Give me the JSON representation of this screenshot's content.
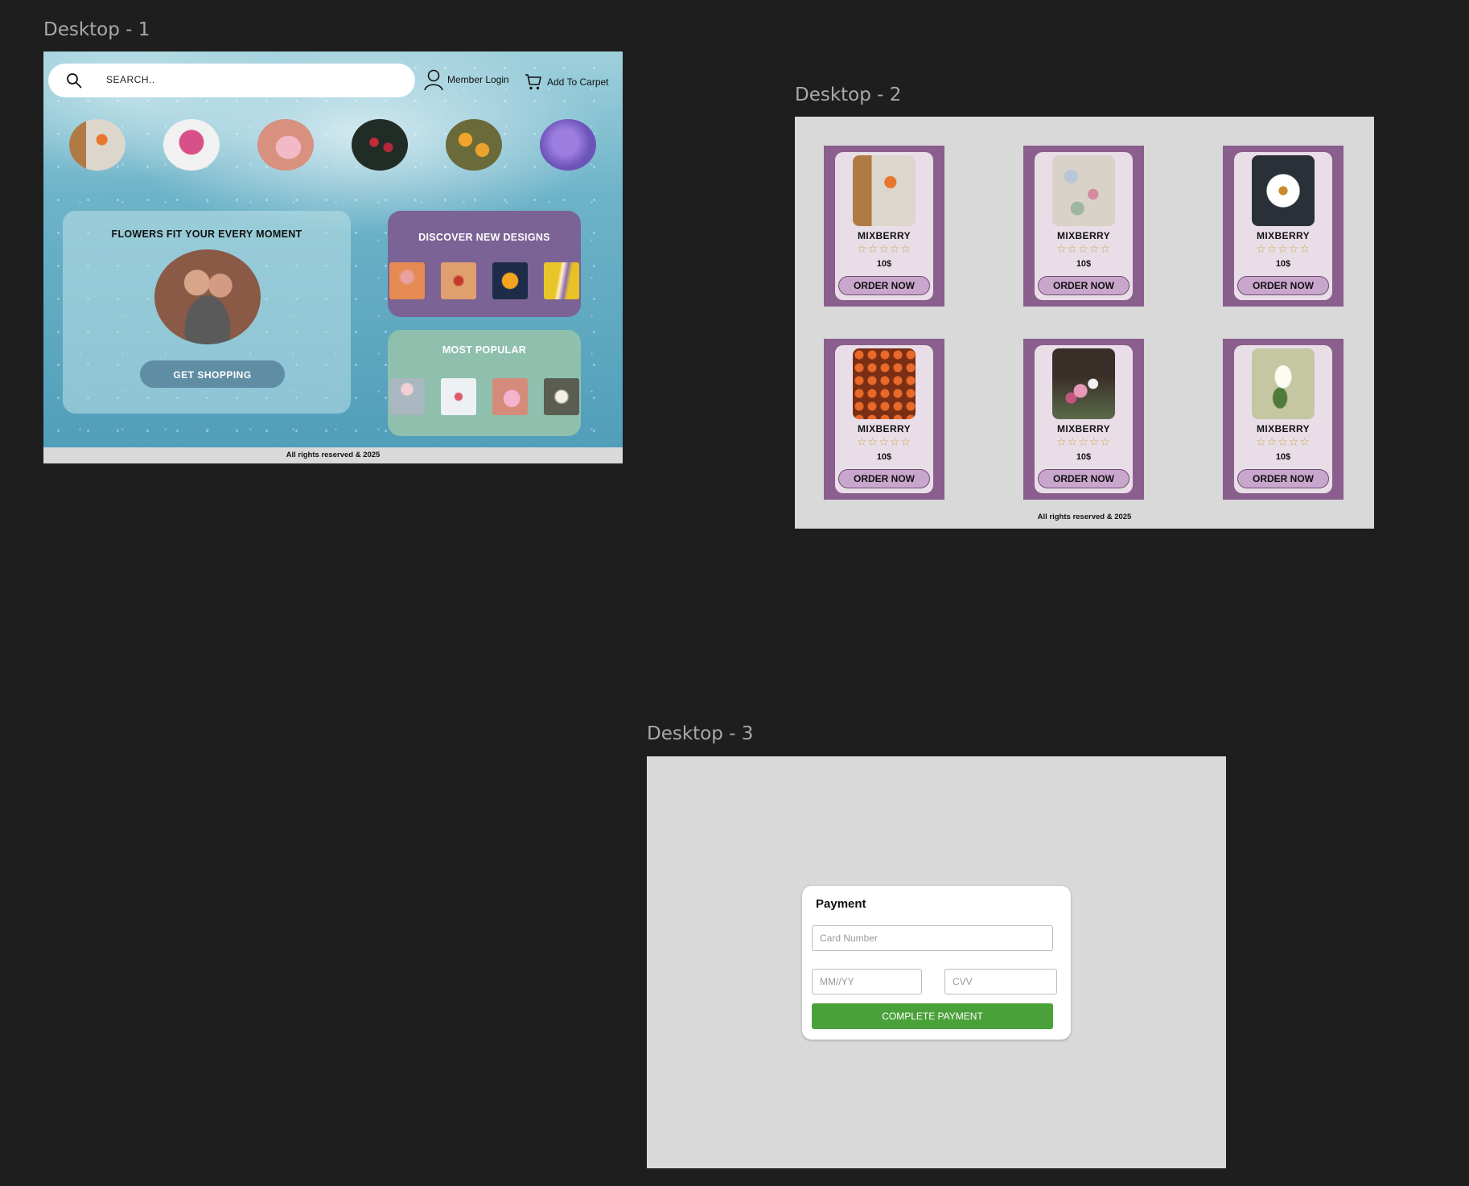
{
  "frames": {
    "d1_label": "Desktop - 1",
    "d2_label": "Desktop - 2",
    "d3_label": "Desktop - 3"
  },
  "desktop1": {
    "search_placeholder": "SEARCH..",
    "member_login": "Member Login",
    "add_to_cart": "Add To Carpet",
    "categories": [
      "orange-vase-flower",
      "pink-peony",
      "pink-petal",
      "dark-red-roses",
      "orange-daisies",
      "purple-hydrangea"
    ],
    "hero": {
      "title": "FLOWERS FIT YOUR EVERY MOMENT",
      "button": "GET SHOPPING"
    },
    "discover": {
      "title": "DISCOVER NEW DESIGNS"
    },
    "popular": {
      "title": "MOST POPULAR"
    },
    "footer": "All rights reserved & 2025"
  },
  "desktop2": {
    "products": [
      {
        "name": "MIXBERRY",
        "stars": "☆☆☆☆☆",
        "price": "10$",
        "button": "ORDER NOW"
      },
      {
        "name": "MIXBERRY",
        "stars": "☆☆☆☆☆",
        "price": "10$",
        "button": "ORDER NOW"
      },
      {
        "name": "MIXBERRY",
        "stars": "☆☆☆☆☆",
        "price": "10$",
        "button": "ORDER NOW"
      },
      {
        "name": "MIXBERRY",
        "stars": "☆☆☆☆☆",
        "price": "10$",
        "button": "ORDER NOW"
      },
      {
        "name": "MIXBERRY",
        "stars": "☆☆☆☆☆",
        "price": "10$",
        "button": "ORDER NOW"
      },
      {
        "name": "MIXBERRY",
        "stars": "☆☆☆☆☆",
        "price": "10$",
        "button": "ORDER NOW"
      }
    ],
    "footer": "All rights reserved & 2025"
  },
  "desktop3": {
    "title": "Payment",
    "card_number_placeholder": "Card Number",
    "expiry_placeholder": "MM//YY",
    "cvv_placeholder": "CVV",
    "submit": "COMPLETE PAYMENT"
  },
  "colors": {
    "canvas": "#1e1e1e",
    "frame_gray": "#d9d9d9",
    "product_purple": "#8a5e8d",
    "order_button": "#c9a7cd",
    "discover_card": "#7b6395",
    "popular_card": "#8fbfad",
    "shop_button": "#5f8ea4",
    "pay_button": "#4aa13a"
  }
}
